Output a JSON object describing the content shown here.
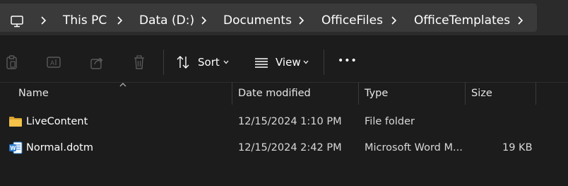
{
  "breadcrumb": {
    "items": [
      "This PC",
      "Data (D:)",
      "Documents",
      "OfficeFiles",
      "OfficeTemplates"
    ]
  },
  "toolbar": {
    "sort_label": "Sort",
    "view_label": "View",
    "more_label": "•••"
  },
  "columns": {
    "name": "Name",
    "date_modified": "Date modified",
    "type": "Type",
    "size": "Size"
  },
  "files": [
    {
      "name": "LiveContent",
      "date": "12/15/2024 1:10 PM",
      "type": "File folder",
      "size": "",
      "icon": "folder-icon"
    },
    {
      "name": "Normal.dotm",
      "date": "12/15/2024 2:42 PM",
      "type": "Microsoft Word M...",
      "size": "19 KB",
      "icon": "word-document-icon"
    }
  ],
  "colors": {
    "folder": "#f5c24a",
    "word": "#2b7cd3",
    "background": "#1c1c1c",
    "addressbar": "#3a3a3a"
  }
}
